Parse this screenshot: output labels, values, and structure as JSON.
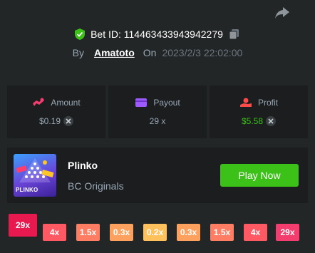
{
  "header": {
    "bet_label": "Bet ID: 114463433943942279",
    "by_label": "By",
    "username": "Amatoto",
    "on_label": "On",
    "timestamp": "2023/2/3 22:02:00"
  },
  "stats": [
    {
      "icon": "amount-icon",
      "label": "Amount",
      "value": "$0.19",
      "coin": true,
      "color": "#98a7b5",
      "icon_color": "#f23d6e"
    },
    {
      "icon": "payout-icon",
      "label": "Payout",
      "value": "29 x",
      "coin": false,
      "color": "#98a7b5",
      "icon_color": "#9d5bff"
    },
    {
      "icon": "profit-icon",
      "label": "Profit",
      "value": "$5.58",
      "coin": true,
      "color": "#3bc117",
      "icon_color": "#ff4a4a"
    }
  ],
  "game": {
    "thumb_label": "PLINKO",
    "name": "Plinko",
    "provider": "BC Originals",
    "play_label": "Play Now"
  },
  "multipliers": {
    "highlight": {
      "label": "29x",
      "color": "#e8194f"
    },
    "slots": [
      {
        "label": "4x",
        "color": "#ff5a63"
      },
      {
        "label": "1.5x",
        "color": "#ff7d62"
      },
      {
        "label": "0.3x",
        "color": "#ffa15e"
      },
      {
        "label": "0.2x",
        "color": "#ffc15c"
      },
      {
        "label": "0.3x",
        "color": "#ffa15e"
      },
      {
        "label": "1.5x",
        "color": "#ff7d62"
      },
      {
        "label": "4x",
        "color": "#ff5a63"
      },
      {
        "label": "29x",
        "color": "#f23d6e"
      }
    ]
  }
}
